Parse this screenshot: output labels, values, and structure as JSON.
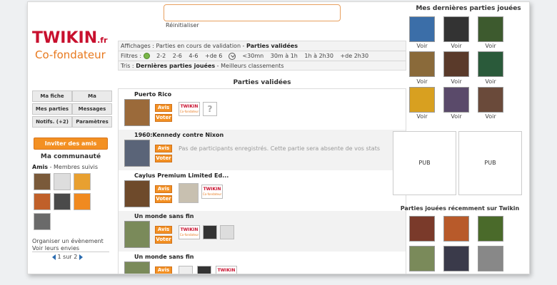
{
  "logo": {
    "word": "TWIKIN",
    "suffix": ".fr",
    "subtitle": "Co-fondateur"
  },
  "search": {
    "value": "",
    "reset_label": "Réinitialiser"
  },
  "filters": {
    "affichages_label": "Affichages :",
    "affichages_options": [
      "Parties en cours de validation",
      "Parties validées"
    ],
    "filtres_label": "Filtres :",
    "player_filters": [
      "2-2",
      "2-6",
      "4-6",
      "+de 6"
    ],
    "time_filters": [
      "<30mn",
      "30m à 1h",
      "1h à 2h30",
      "+de 2h30"
    ],
    "tris_label": "Tris :",
    "tris_options": [
      "Dernières parties jouées",
      "Meilleurs classements"
    ]
  },
  "menu": {
    "items": [
      "Ma fiche",
      "Ma ludosphère",
      "Mes parties",
      "Messages",
      "Notifs. (+2)",
      "Paramètres"
    ],
    "invite_label": "Inviter des amis",
    "community_title": "Ma communauté",
    "friends_label": "Amis",
    "followed_label": "Membres suivis",
    "organize_label": "Organiser un évènement",
    "envies_label": "Voir leurs envies",
    "pager": "1 sur 2"
  },
  "list": {
    "title": "Parties validées",
    "avis_label": "Avis",
    "voter_label": "Voter",
    "no_participants": "Pas de participants enregistrés. Cette partie sera absente de vos stats",
    "games": [
      {
        "name": "Puerto Rico",
        "color": "#9b6a3a"
      },
      {
        "name": "1960:Kennedy contre Nixon",
        "color": "#5a6478"
      },
      {
        "name": "Caylus Premium Limited Ed...",
        "color": "#6e4a2b"
      },
      {
        "name": "Un monde sans fin",
        "color": "#7a8a5a"
      },
      {
        "name": "Un monde sans fin",
        "color": "#7a8a5a"
      }
    ]
  },
  "right": {
    "title": "Mes dernières parties jouées",
    "voir_label": "Voir",
    "recent_colors": [
      "#3b6ea8",
      "#333333",
      "#3d5a2e",
      "#8a6a3a",
      "#5a3a2a",
      "#2a5a3a",
      "#d8a020",
      "#5a4a6a",
      "#6a4a3a"
    ],
    "pub_label": "PUB",
    "title2": "Parties jouées récemment sur Twikin",
    "recent_site_colors": [
      "#7a3a2a",
      "#b85a2a",
      "#4a6a2a",
      "#7a8a5a",
      "#3a3a4a",
      "#888888"
    ]
  },
  "colors": {
    "accent": "#f39023",
    "brand": "#c8102e"
  }
}
